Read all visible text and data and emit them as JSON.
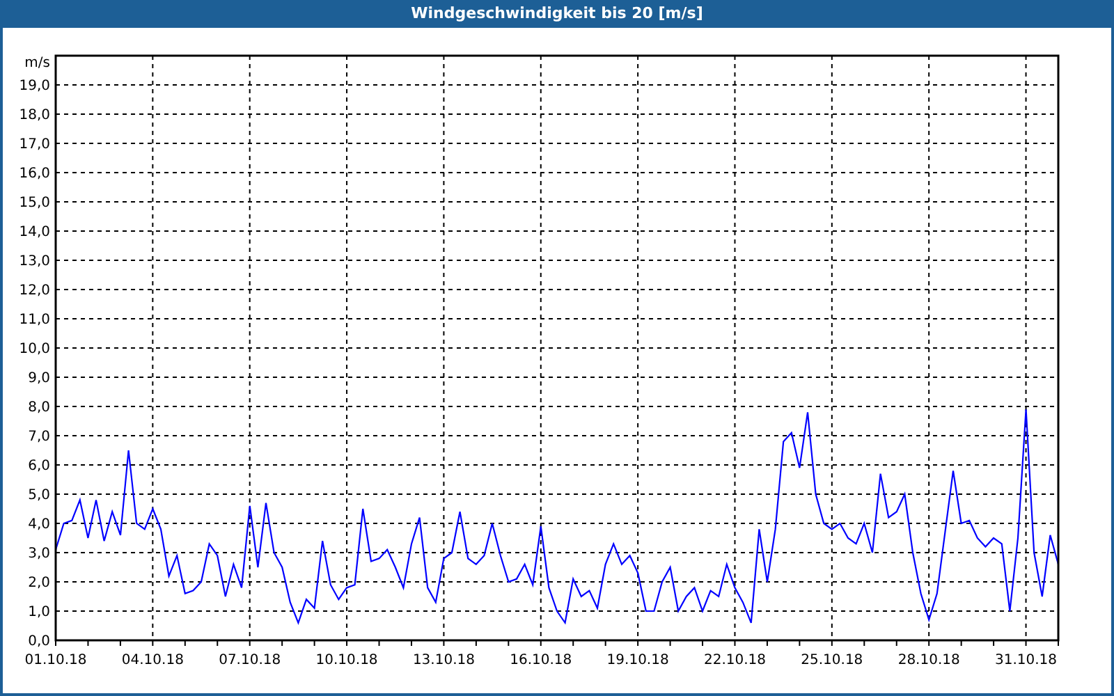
{
  "window": {
    "title": "Windgeschwindigkeit bis 20 [m/s]"
  },
  "chart": {
    "chart_data": {
      "type": "line",
      "grid": true,
      "ylabel": "m/s",
      "ylim": [
        0,
        20
      ],
      "categories": [
        "01.10.18",
        null,
        null,
        null,
        null,
        null,
        null,
        null,
        null,
        null,
        null,
        null,
        "04.10.18",
        null,
        null,
        null,
        null,
        null,
        null,
        null,
        null,
        null,
        null,
        null,
        "07.10.18",
        null,
        null,
        null,
        null,
        null,
        null,
        null,
        null,
        null,
        null,
        null,
        "10.10.18",
        null,
        null,
        null,
        null,
        null,
        null,
        null,
        null,
        null,
        null,
        null,
        "13.10.18",
        null,
        null,
        null,
        null,
        null,
        null,
        null,
        null,
        null,
        null,
        null,
        "16.10.18",
        null,
        null,
        null,
        null,
        null,
        null,
        null,
        null,
        null,
        null,
        null,
        "19.10.18",
        null,
        null,
        null,
        null,
        null,
        null,
        null,
        null,
        null,
        null,
        null,
        "22.10.18",
        null,
        null,
        null,
        null,
        null,
        null,
        null,
        null,
        null,
        null,
        null,
        "25.10.18",
        null,
        null,
        null,
        null,
        null,
        null,
        null,
        null,
        null,
        null,
        null,
        "28.10.18",
        null,
        null,
        null,
        null,
        null,
        null,
        null,
        null,
        null,
        null,
        null,
        "31.10.18",
        null,
        null,
        null,
        null
      ],
      "yticks": [
        {
          "value": 0,
          "label": "0,0"
        },
        {
          "value": 1,
          "label": "1,0"
        },
        {
          "value": 2,
          "label": "2,0"
        },
        {
          "value": 3,
          "label": "3,0"
        },
        {
          "value": 4,
          "label": "4,0"
        },
        {
          "value": 5,
          "label": "5,0"
        },
        {
          "value": 6,
          "label": "6,0"
        },
        {
          "value": 7,
          "label": "7,0"
        },
        {
          "value": 8,
          "label": "8,0"
        },
        {
          "value": 9,
          "label": "9,0"
        },
        {
          "value": 10,
          "label": "10,0"
        },
        {
          "value": 11,
          "label": "11,0"
        },
        {
          "value": 12,
          "label": "12,0"
        },
        {
          "value": 13,
          "label": "13,0"
        },
        {
          "value": 14,
          "label": "14,0"
        },
        {
          "value": 15,
          "label": "15,0"
        },
        {
          "value": 16,
          "label": "16,0"
        },
        {
          "value": 17,
          "label": "17,0"
        },
        {
          "value": 18,
          "label": "18,0"
        },
        {
          "value": 19,
          "label": "19,0"
        }
      ],
      "series": [
        {
          "color": "#0000ff",
          "values": [
            3.1,
            4.0,
            4.1,
            4.8,
            3.5,
            4.8,
            3.4,
            4.4,
            3.6,
            6.5,
            4.0,
            3.8,
            4.5,
            3.8,
            2.2,
            2.9,
            1.6,
            1.7,
            2.0,
            3.3,
            2.9,
            1.5,
            2.6,
            1.8,
            4.6,
            2.5,
            4.7,
            3.0,
            2.5,
            1.3,
            0.6,
            1.4,
            1.1,
            3.4,
            1.9,
            1.4,
            1.8,
            1.9,
            4.5,
            2.7,
            2.8,
            3.1,
            2.5,
            1.8,
            3.3,
            4.2,
            1.8,
            1.3,
            2.8,
            3.0,
            4.4,
            2.8,
            2.6,
            2.9,
            4.0,
            2.9,
            2.0,
            2.1,
            2.6,
            1.9,
            3.9,
            1.8,
            1.0,
            0.6,
            2.1,
            1.5,
            1.7,
            1.1,
            2.6,
            3.3,
            2.6,
            2.9,
            2.3,
            1.0,
            1.0,
            2.0,
            2.5,
            1.0,
            1.5,
            1.8,
            1.0,
            1.7,
            1.5,
            2.6,
            1.8,
            1.3,
            0.6,
            3.8,
            2.0,
            3.8,
            6.8,
            7.1,
            5.9,
            7.8,
            5.0,
            4.0,
            3.8,
            4.0,
            3.5,
            3.3,
            4.0,
            3.0,
            5.7,
            4.2,
            4.4,
            5.0,
            3.0,
            1.6,
            0.7,
            1.6,
            3.7,
            5.8,
            4.0,
            4.1,
            3.5,
            3.2,
            3.5,
            3.3,
            1.0,
            3.5,
            7.9,
            3.0,
            1.5,
            3.6,
            2.6
          ]
        }
      ]
    }
  }
}
